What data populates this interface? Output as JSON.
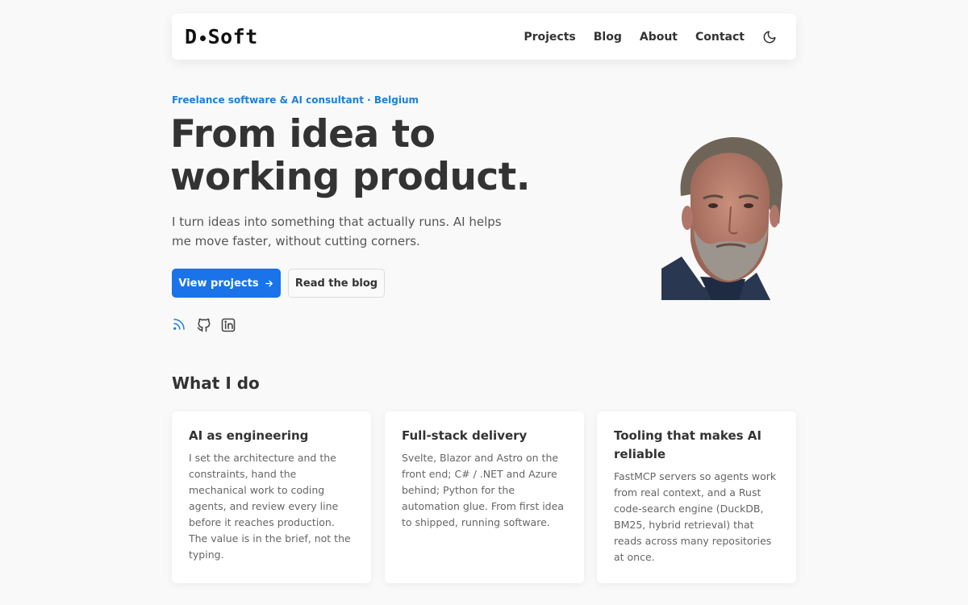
{
  "nav": {
    "logo_left": "D",
    "logo_right": "Soft",
    "links": [
      "Projects",
      "Blog",
      "About",
      "Contact"
    ]
  },
  "hero": {
    "tagline": "Freelance software & AI consultant · Belgium",
    "title": "From idea to working product.",
    "subtitle": "I turn ideas into something that actually runs. AI helps me move faster, without cutting corners.",
    "primary_label": "View projects",
    "secondary_label": "Read the blog"
  },
  "section": {
    "title": "What I do"
  },
  "cards": [
    {
      "title": "AI as engineering",
      "body": "I set the architecture and the constraints, hand the mechanical work to coding agents, and review every line before it reaches production. The value is in the brief, not the typing."
    },
    {
      "title": "Full-stack delivery",
      "body": "Svelte, Blazor and Astro on the front end; C# / .NET and Azure behind; Python for the automation glue. From first idea to shipped, running software."
    },
    {
      "title": "Tooling that makes AI reliable",
      "body": "FastMCP servers so agents work from real context, and a Rust code-search engine (DuckDB, BM25, hybrid retrieval) that reads across many repositories at once."
    }
  ],
  "colors": {
    "accent": "#1a73e8",
    "tagline": "#1e7fd6",
    "background": "#f9f9f9"
  },
  "icons": [
    "moon-icon",
    "arrow-right-icon",
    "rss-icon",
    "github-icon",
    "linkedin-icon"
  ]
}
